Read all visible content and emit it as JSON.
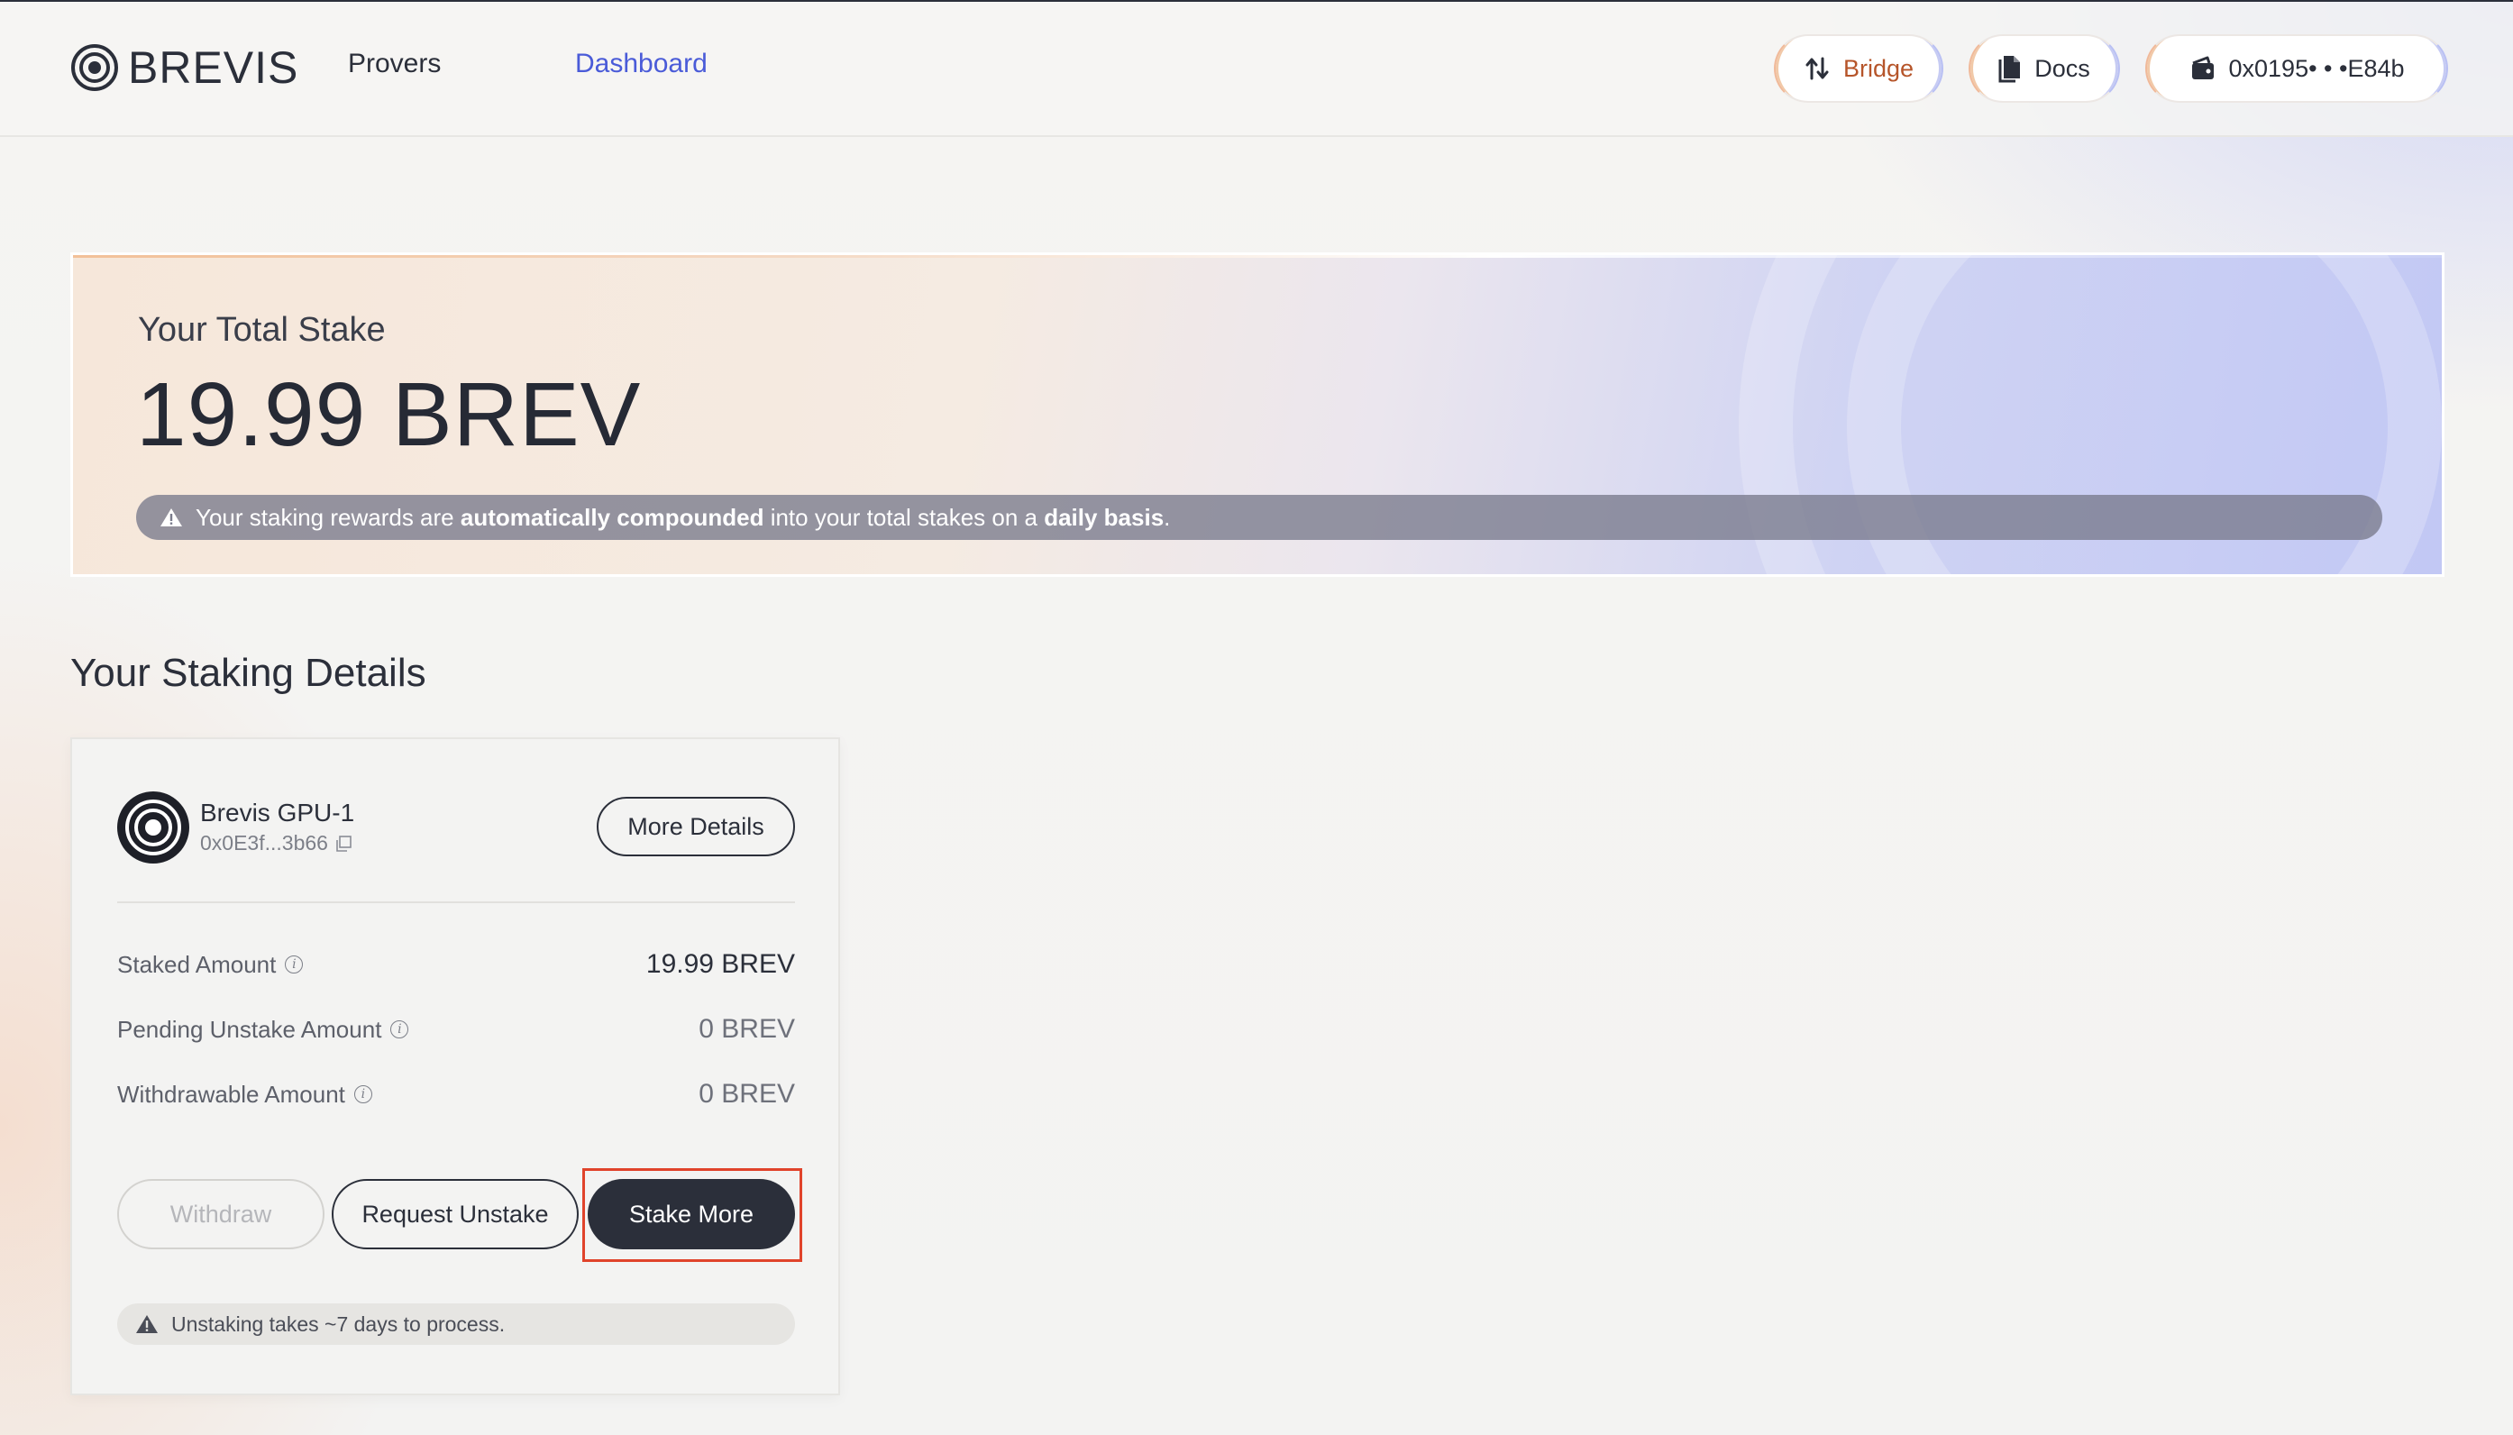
{
  "app": {
    "logo_text": "BREVIS"
  },
  "nav": {
    "links": [
      {
        "label": "Provers"
      },
      {
        "label": "Dashboard"
      }
    ],
    "bridge_label": "Bridge",
    "docs_label": "Docs",
    "wallet_label": "0x0195• • •E84b"
  },
  "hero": {
    "label": "Your Total Stake",
    "amount": "19.99 BREV",
    "banner": {
      "part1": "Your staking rewards are ",
      "bold1": "automatically compounded",
      "part2": " into your total stakes on a ",
      "bold2": "daily basis",
      "part3": "."
    }
  },
  "details": {
    "title": "Your Staking Details",
    "prover": {
      "name": "Brevis GPU-1",
      "address": "0x0E3f...3b66"
    },
    "more_details_label": "More Details",
    "stats": [
      {
        "label": "Staked Amount",
        "value": "19.99 BREV"
      },
      {
        "label": "Pending Unstake Amount",
        "value": "0 BREV"
      },
      {
        "label": "Withdrawable Amount",
        "value": "0 BREV"
      }
    ],
    "buttons": {
      "withdraw": "Withdraw",
      "request_unstake": "Request Unstake",
      "stake_more": "Stake More"
    },
    "note": "Unstaking takes ~7 days to process."
  },
  "colors": {
    "accent": "#4a5bd8",
    "dark": "#2b2f3a",
    "bridge": "#b6552a",
    "highlight": "#e0432b"
  }
}
